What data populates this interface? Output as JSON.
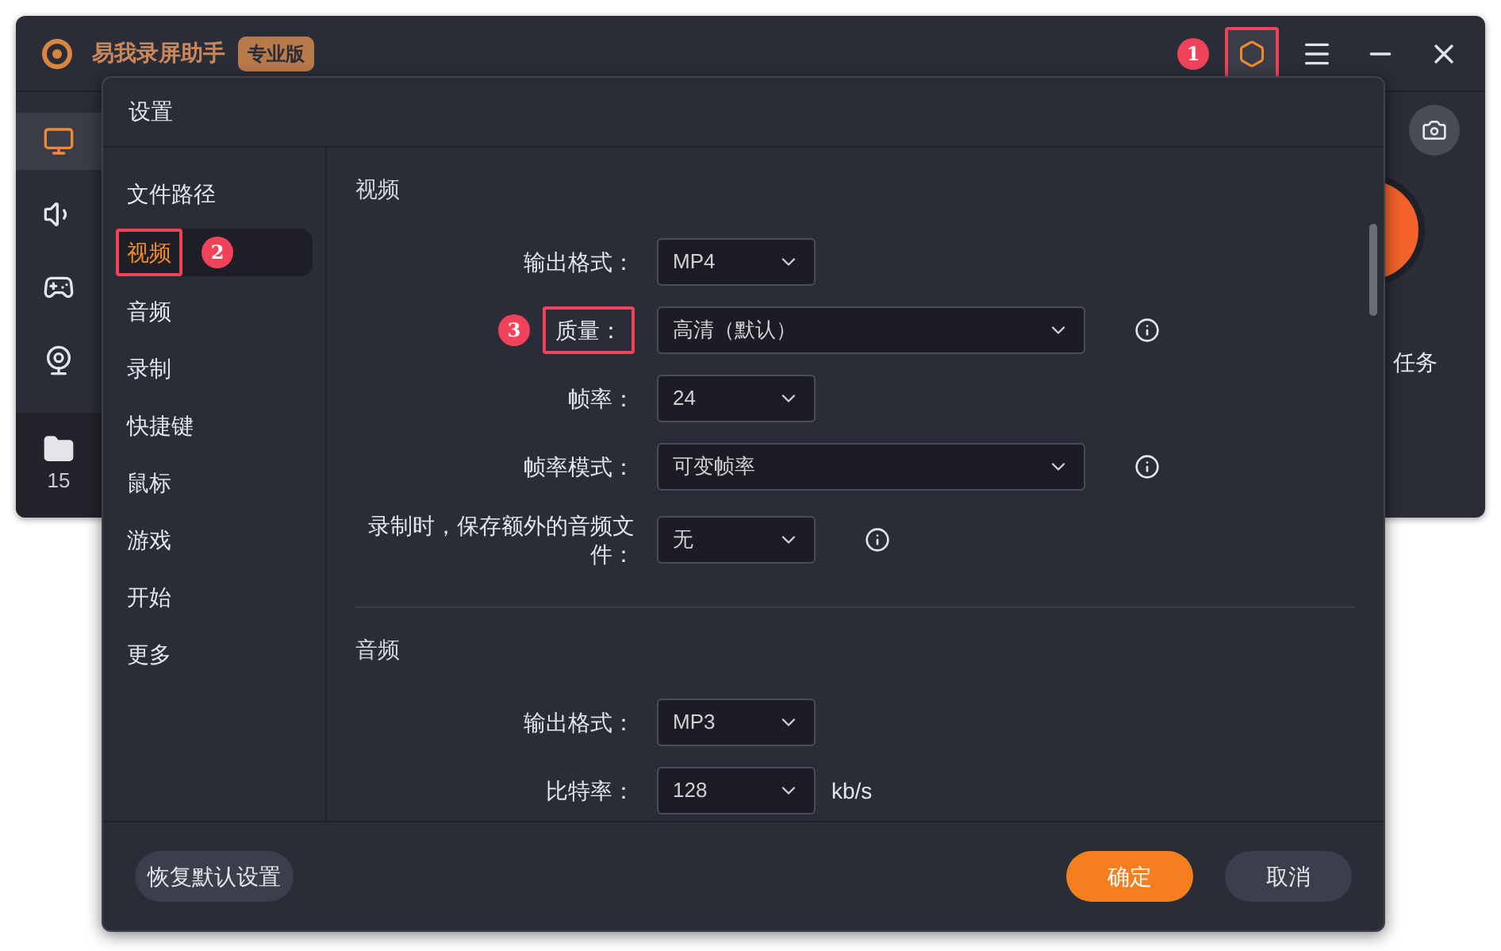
{
  "app": {
    "title": "易我录屏助手",
    "edition": "专业版",
    "settings_marker": "1",
    "rail": [
      {
        "kind": "screen",
        "selected": true
      },
      {
        "kind": "audio",
        "selected": false
      },
      {
        "kind": "game",
        "selected": false
      },
      {
        "kind": "webcam",
        "selected": false
      }
    ],
    "files_count": "15",
    "task_text": "任务"
  },
  "dialog": {
    "title": "设置",
    "sidebar": [
      {
        "label": "文件路径",
        "selected": false
      },
      {
        "label": "视频",
        "selected": true,
        "marker": "2"
      },
      {
        "label": "音频",
        "selected": false
      },
      {
        "label": "录制",
        "selected": false
      },
      {
        "label": "快捷键",
        "selected": false
      },
      {
        "label": "鼠标",
        "selected": false
      },
      {
        "label": "游戏",
        "selected": false
      },
      {
        "label": "开始",
        "selected": false
      },
      {
        "label": "更多",
        "selected": false
      }
    ],
    "sections": [
      {
        "title": "视频",
        "fields": [
          {
            "label": "输出格式：",
            "value": "MP4",
            "kind": "short",
            "info": false
          },
          {
            "label": "质量：",
            "value": "高清（默认）",
            "kind": "long",
            "info": true,
            "marker": "3"
          },
          {
            "label": "帧率：",
            "value": "24",
            "kind": "short",
            "info": false
          },
          {
            "label": "帧率模式：",
            "value": "可变帧率",
            "kind": "long",
            "info": true
          },
          {
            "label": "录制时，保存额外的音频文件：",
            "value": "无",
            "kind": "short",
            "info": true
          }
        ]
      },
      {
        "title": "音频",
        "fields": [
          {
            "label": "输出格式：",
            "value": "MP3",
            "kind": "short",
            "info": false
          },
          {
            "label": "比特率：",
            "value": "128",
            "kind": "short",
            "info": false,
            "unit": "kb/s"
          }
        ]
      }
    ],
    "reset_button": "恢复默认设置",
    "ok_button": "确定",
    "cancel_button": "取消"
  }
}
